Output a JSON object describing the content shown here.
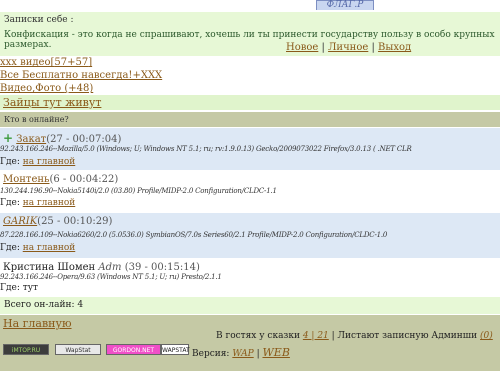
{
  "logo": "ФЛАГ.Р",
  "notes": {
    "title": "Записки себе :",
    "text": "Конфискация - это когда не спрашивают, хочешь ли ты принести государству пользу в особо крупных размерах.",
    "nav": {
      "new": "Новое",
      "personal": "Личное",
      "exit": "Выход",
      "sep": "|"
    }
  },
  "links": [
    {
      "text": "xxx видео[",
      "count": "57+57",
      "close": "]"
    },
    {
      "text": "Все Бесплатно навсегда!+XXX"
    },
    {
      "text": "Видео,Фото ",
      "count": "(+48)"
    }
  ],
  "zaits": "Зайцы тут живут",
  "who_online": "Кто в онлайне?",
  "users": [
    {
      "plus": "+",
      "name": "Закат",
      "meta": "(27 - 00:07:04)",
      "ua": "92.243.166.246--Mozilla/5.0 (Windows; U; Windows NT 5.1; ru; rv:1.9.0.13) Gecko/2009073022 Firefox/3.0.13 ( .NET CLR",
      "where_label": "Где:",
      "where": "на главной"
    },
    {
      "name": "Монтень",
      "meta": "(6 - 00:04:22)",
      "ua": "130.244.196.90--Nokia5140i/2.0 (03.80) Profile/MIDP-2.0 Configuration/CLDC-1.1",
      "where_label": "Где:",
      "where": "на главной"
    },
    {
      "name": "GARIK",
      "meta": "(25 - 00:10:29)",
      "ua": "87.228.166.109--Nokia6260/2.0 (5.0536.0) SymbianOS/7.0s Series60/2.1 Profile/MIDP-2.0 Configuration/CLDC-1.0",
      "where_label": "Где:",
      "where": "на главной"
    },
    {
      "name": "Кристина Шомен",
      "role": "Adm",
      "meta": "(39 - 00:15:14)",
      "ua": "92.243.166.246--Opera/9.63 (Windows NT 5.1; U; ru) Presto/2.1.1",
      "where_label": "Где:",
      "where": "тут"
    }
  ],
  "total": "Всего он-лайн: 4",
  "home": "На главную",
  "guests": {
    "prefix": "В гостях у сказки",
    "count": "4 | 21",
    "mid": "| Листают записную Админши",
    "admin_count": "(0)"
  },
  "version": {
    "label": "Версия:",
    "wap": "WAP",
    "sep": "|",
    "web": "WEB"
  },
  "counters": [
    "iMTOP.RU",
    "WapStat",
    "GORDON.NET",
    "WAPSTAT"
  ]
}
